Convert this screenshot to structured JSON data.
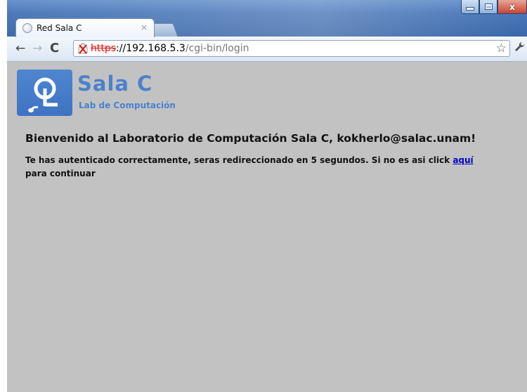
{
  "browser": {
    "tab_title": "Red Sala C",
    "tab_close": "×",
    "url_scheme": "https",
    "url_host": "://192.168.5.3",
    "url_path": "/cgi-bin/login"
  },
  "window_controls": {
    "close": "x"
  },
  "page": {
    "logo_name": "Sala C",
    "logo_subtitle": "Lab de Computación",
    "welcome": "Bienvenido al Laboratorio de Computación Sala C, kokherlo@salac.unam!",
    "message_before": "Te has autenticado correctamente, seras redireccionado en 5 segundos. Si no es asi click ",
    "link_text": "aquí",
    "message_after": " para continuar"
  },
  "colors": {
    "content_background": "#c2c2c2",
    "logo_blue": "#4a82cc",
    "link": "#0000cc",
    "insecure_red": "#d11"
  },
  "icons": [
    "globe-favicon-icon",
    "back-arrow-icon",
    "forward-arrow-icon",
    "reload-icon",
    "insecure-lock-icon",
    "bookmark-star-icon",
    "wrench-icon",
    "logo-icon"
  ]
}
